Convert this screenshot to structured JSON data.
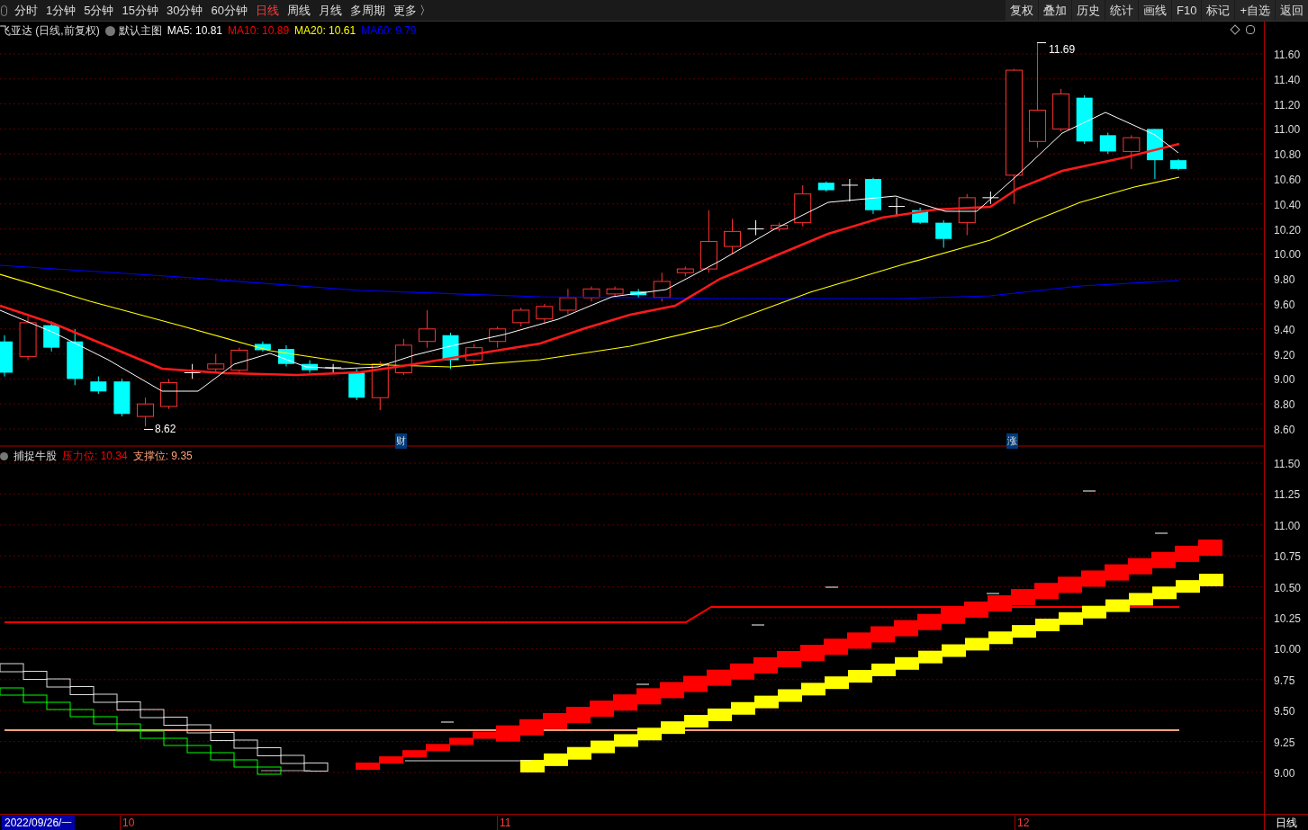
{
  "toolbar": {
    "periods": [
      {
        "label": "分时",
        "selected": false
      },
      {
        "label": "1分钟",
        "selected": false
      },
      {
        "label": "5分钟",
        "selected": false
      },
      {
        "label": "15分钟",
        "selected": false
      },
      {
        "label": "30分钟",
        "selected": false
      },
      {
        "label": "60分钟",
        "selected": false
      },
      {
        "label": "日线",
        "selected": true
      },
      {
        "label": "周线",
        "selected": false
      },
      {
        "label": "月线",
        "selected": false
      },
      {
        "label": "多周期",
        "selected": false
      },
      {
        "label": "更多 〉",
        "selected": false
      }
    ],
    "buttons": [
      "复权",
      "叠加",
      "历史",
      "统计",
      "画线",
      "F10",
      "标记",
      "+自选",
      "返回"
    ]
  },
  "main_chart": {
    "title": "飞亚达 (日线,前复权)",
    "template": "默认主图",
    "legend": [
      {
        "text": "MA5: 10.81",
        "color": "#ffffff"
      },
      {
        "text": "MA10: 10.89",
        "color": "#ff0000"
      },
      {
        "text": "MA20: 10.61",
        "color": "#ffff00"
      },
      {
        "text": "MA60: 9.79",
        "color": "#0000ff"
      }
    ],
    "high_label": "11.69",
    "low_label": "8.62",
    "event_markers": [
      "财",
      "涨"
    ],
    "yticks": [
      "11.60",
      "11.40",
      "11.20",
      "11.00",
      "10.80",
      "10.60",
      "10.40",
      "10.20",
      "10.00",
      "9.80",
      "9.60",
      "9.40",
      "9.20",
      "9.00",
      "8.80",
      "8.60"
    ]
  },
  "indicator_chart": {
    "name": "捕捉牛股",
    "legend": [
      {
        "text": "压力位: 10.34",
        "color": "#ff0000"
      },
      {
        "text": "支撑位: 9.35",
        "color": "#ffa07a"
      }
    ],
    "yticks": [
      "11.50",
      "11.25",
      "11.00",
      "10.75",
      "10.50",
      "10.25",
      "10.00",
      "9.75",
      "9.50",
      "9.25",
      "9.00"
    ]
  },
  "time_axis": {
    "cursor_date": "2022/09/26/一",
    "months": [
      "10",
      "11",
      "12"
    ],
    "period": "日线"
  }
}
